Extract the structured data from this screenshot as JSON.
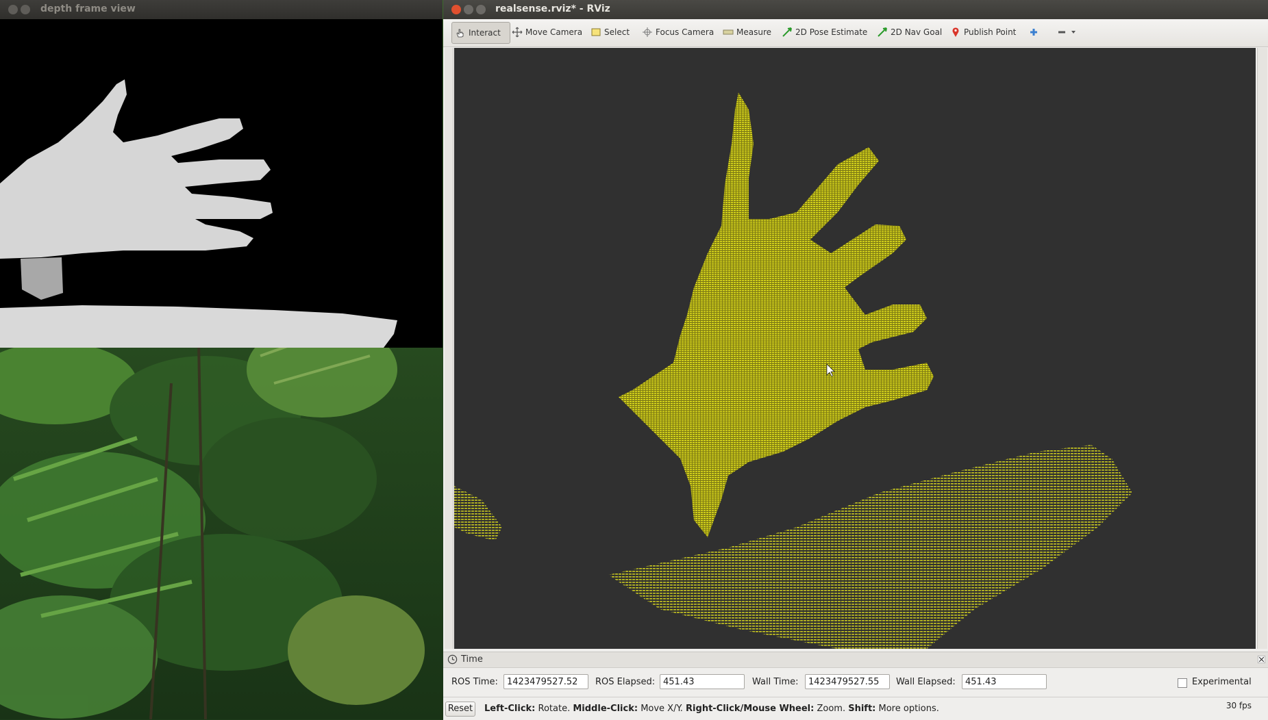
{
  "depth_window": {
    "title": "depth frame view",
    "image": "grayscale depth image of an open hand above a table surface"
  },
  "desktop": {
    "background": "forest with tree ferns wallpaper"
  },
  "rviz_window": {
    "title": "realsense.rviz* - RViz",
    "toolbar": {
      "interact": "Interact",
      "move_camera": "Move Camera",
      "select": "Select",
      "focus_camera": "Focus Camera",
      "measure": "Measure",
      "pose_estimate": "2D Pose Estimate",
      "nav_goal": "2D Nav Goal",
      "publish_point": "Publish Point"
    },
    "viewport": {
      "background": "#303030",
      "cloud_color": "#e4e41a",
      "image": "yellow 3D point cloud of an open hand and a table surface"
    },
    "time_panel": {
      "title": "Time",
      "ros_time_label": "ROS Time:",
      "ros_time": "1423479527.52",
      "ros_elapsed_label": "ROS Elapsed:",
      "ros_elapsed": "451.43",
      "wall_time_label": "Wall Time:",
      "wall_time": "1423479527.55",
      "wall_elapsed_label": "Wall Elapsed:",
      "wall_elapsed": "451.43",
      "experimental_label": "Experimental",
      "experimental_checked": false
    },
    "status_bar": {
      "reset": "Reset",
      "hint_left_click": "Left-Click:",
      "hint_rotate": "Rotate.",
      "hint_middle_click": "Middle-Click:",
      "hint_move": "Move X/Y.",
      "hint_right_click": "Right-Click/Mouse Wheel:",
      "hint_zoom": "Zoom.",
      "hint_shift": "Shift:",
      "hint_more": "More options.",
      "fps": "30 fps"
    }
  }
}
